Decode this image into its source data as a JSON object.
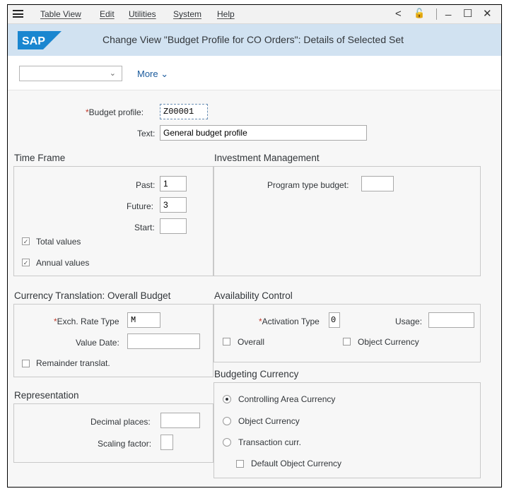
{
  "menu": {
    "items": [
      "Table View",
      "Edit",
      "Utilities",
      "System",
      "Help"
    ],
    "window_controls": {
      "back": "<",
      "unlock": "🔓",
      "minimize": "_",
      "maximize": "☐",
      "close": "✕"
    }
  },
  "title_bar": {
    "logo_text": "SAP",
    "title": "Change View \"Budget Profile for CO Orders\": Details of Selected Set"
  },
  "toolbar": {
    "select_value": "",
    "more_label": "More"
  },
  "header": {
    "budget_profile_label": "Budget profile:",
    "budget_profile_value": "Z00001",
    "text_label": "Text:",
    "text_value": "General budget profile"
  },
  "time_frame": {
    "title": "Time Frame",
    "past_label": "Past:",
    "past_value": "1",
    "future_label": "Future:",
    "future_value": "3",
    "start_label": "Start:",
    "start_value": "",
    "total_values_label": "Total values",
    "total_values_checked": true,
    "annual_values_label": "Annual values",
    "annual_values_checked": true
  },
  "investment_management": {
    "title": "Investment Management",
    "program_type_label": "Program type budget:",
    "program_type_value": ""
  },
  "currency_translation": {
    "title": "Currency Translation: Overall Budget",
    "exch_rate_label": "Exch. Rate Type",
    "exch_rate_value": "M",
    "value_date_label": "Value Date:",
    "value_date_value": "",
    "remainder_label": "Remainder translat.",
    "remainder_checked": false
  },
  "availability_control": {
    "title": "Availability Control",
    "activation_label": "Activation Type",
    "activation_value": "0",
    "usage_label": "Usage:",
    "usage_value": "",
    "overall_label": "Overall",
    "overall_checked": false,
    "object_currency_label": "Object Currency",
    "object_currency_checked": false
  },
  "representation": {
    "title": "Representation",
    "decimal_label": "Decimal places:",
    "decimal_value": "",
    "scaling_label": "Scaling factor:",
    "scaling_value": ""
  },
  "budgeting_currency": {
    "title": "Budgeting Currency",
    "options": [
      "Controlling Area Currency",
      "Object Currency",
      "Transaction curr."
    ],
    "selected_index": 0,
    "default_object_currency_label": "Default Object Currency",
    "default_object_currency_checked": false
  },
  "colors": {
    "title_bar_bg": "#d1e2f1",
    "sap_logo": "#1a86d0",
    "required_marker": "#c0392b"
  }
}
